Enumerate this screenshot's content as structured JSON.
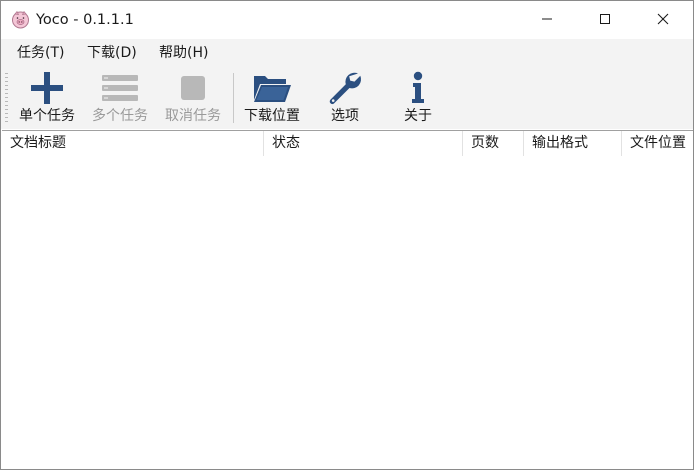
{
  "window": {
    "title": "Yoco - 0.1.1.1"
  },
  "icons": {
    "app": "pig-icon",
    "minimize": "minimize-icon",
    "maximize": "maximize-icon",
    "close": "close-icon"
  },
  "menu": {
    "items": [
      {
        "label": "任务(T)"
      },
      {
        "label": "下载(D)"
      },
      {
        "label": "帮助(H)"
      }
    ]
  },
  "toolbar": {
    "buttons": [
      {
        "label": "单个任务",
        "icon": "plus-icon",
        "enabled": true
      },
      {
        "label": "多个任务",
        "icon": "list-icon",
        "enabled": false
      },
      {
        "label": "取消任务",
        "icon": "stop-icon",
        "enabled": false
      },
      {
        "label": "下载位置",
        "icon": "folder-open-icon",
        "enabled": true
      },
      {
        "label": "选项",
        "icon": "wrench-icon",
        "enabled": true
      },
      {
        "label": "关于",
        "icon": "info-icon",
        "enabled": true
      }
    ]
  },
  "table": {
    "columns": [
      "文档标题",
      "状态",
      "页数",
      "输出格式",
      "文件位置"
    ],
    "rows": []
  },
  "colors": {
    "accent": "#2b4f80",
    "disabled": "#b8b8b8",
    "chrome": "#f3f3f3"
  }
}
